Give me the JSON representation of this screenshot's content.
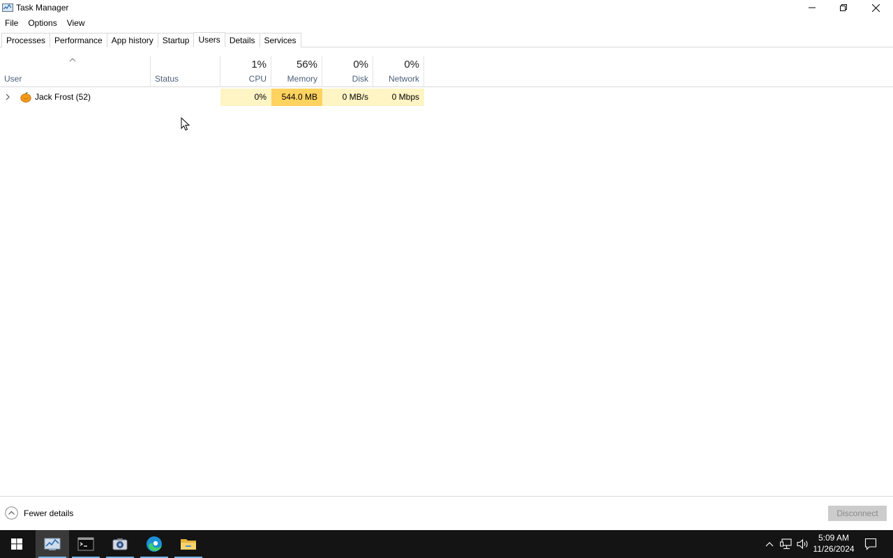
{
  "window": {
    "title": "Task Manager"
  },
  "menu": [
    "File",
    "Options",
    "View"
  ],
  "tabs": [
    {
      "label": "Processes",
      "active": false
    },
    {
      "label": "Performance",
      "active": false
    },
    {
      "label": "App history",
      "active": false
    },
    {
      "label": "Startup",
      "active": false
    },
    {
      "label": "Users",
      "active": true
    },
    {
      "label": "Details",
      "active": false
    },
    {
      "label": "Services",
      "active": false
    }
  ],
  "columns": {
    "user": {
      "label": "User"
    },
    "status": {
      "label": "Status"
    },
    "cpu": {
      "label": "CPU",
      "total": "1%"
    },
    "memory": {
      "label": "Memory",
      "total": "56%"
    },
    "disk": {
      "label": "Disk",
      "total": "0%"
    },
    "network": {
      "label": "Network",
      "total": "0%"
    }
  },
  "rows": [
    {
      "user": "Jack Frost (52)",
      "status": "",
      "cpu": "0%",
      "memory": "544.0 MB",
      "disk": "0 MB/s",
      "network": "0 Mbps"
    }
  ],
  "footer": {
    "fewer_details": "Fewer details",
    "disconnect": "Disconnect"
  },
  "taskbar": {
    "apps": [
      "start-icon",
      "task-manager-icon",
      "terminal-icon",
      "camera-icon",
      "edge-icon",
      "file-explorer-icon"
    ],
    "time": "5:09 AM",
    "date": "11/26/2024"
  },
  "colors": {
    "heat_low": "#fff4c4",
    "heat_high": "#ffd35f",
    "header_text": "#4c607a",
    "taskbar_bg": "#141414"
  }
}
